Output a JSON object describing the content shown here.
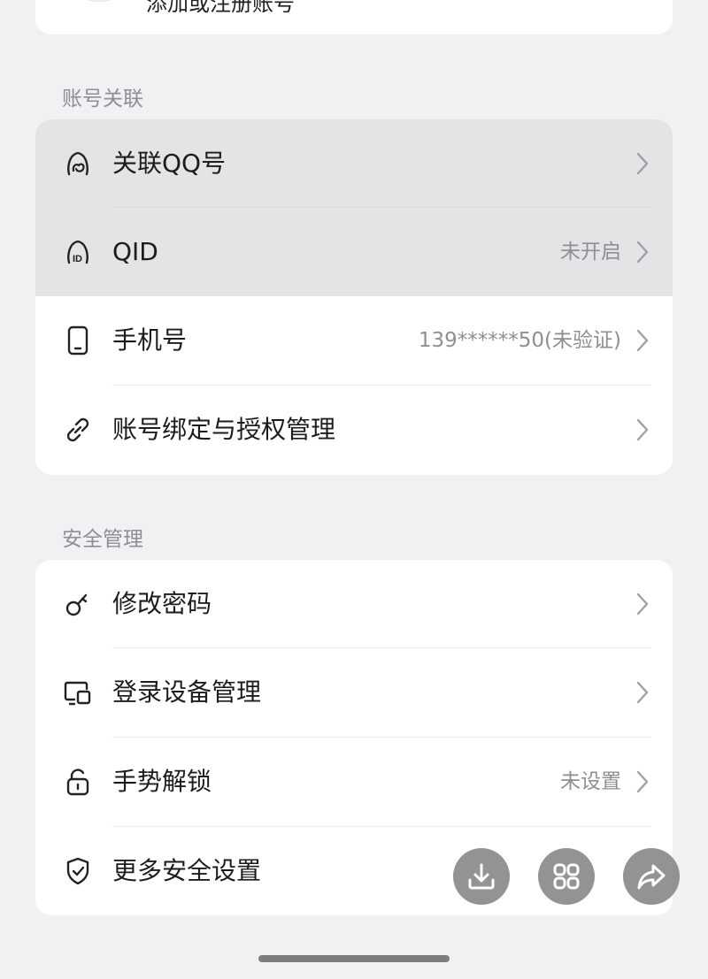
{
  "top_card": {
    "text": "添加或注册账号"
  },
  "sections": [
    {
      "title": "账号关联",
      "rows": [
        {
          "label": "关联QQ号",
          "value": "",
          "icon": "qq-icon"
        },
        {
          "label": "QID",
          "value": "未开启",
          "icon": "qid-icon"
        },
        {
          "label": "手机号",
          "value": "139******50(未验证)",
          "icon": "phone-icon"
        },
        {
          "label": "账号绑定与授权管理",
          "value": "",
          "icon": "link-icon"
        }
      ]
    },
    {
      "title": "安全管理",
      "rows": [
        {
          "label": "修改密码",
          "value": "",
          "icon": "key-icon"
        },
        {
          "label": "登录设备管理",
          "value": "",
          "icon": "devices-icon"
        },
        {
          "label": "手势解锁",
          "value": "未设置",
          "icon": "lock-icon"
        },
        {
          "label": "更多安全设置",
          "value": "",
          "icon": "shield-icon"
        }
      ]
    }
  ],
  "floating_actions": [
    {
      "icon": "download-icon"
    },
    {
      "icon": "grid-icon"
    },
    {
      "icon": "share-icon"
    }
  ],
  "colors": {
    "background": "#f1f1f4",
    "card": "#ffffff",
    "pressed_row": "#e4e4e6",
    "secondary_text": "#8e8e93",
    "fab": "#808080"
  }
}
